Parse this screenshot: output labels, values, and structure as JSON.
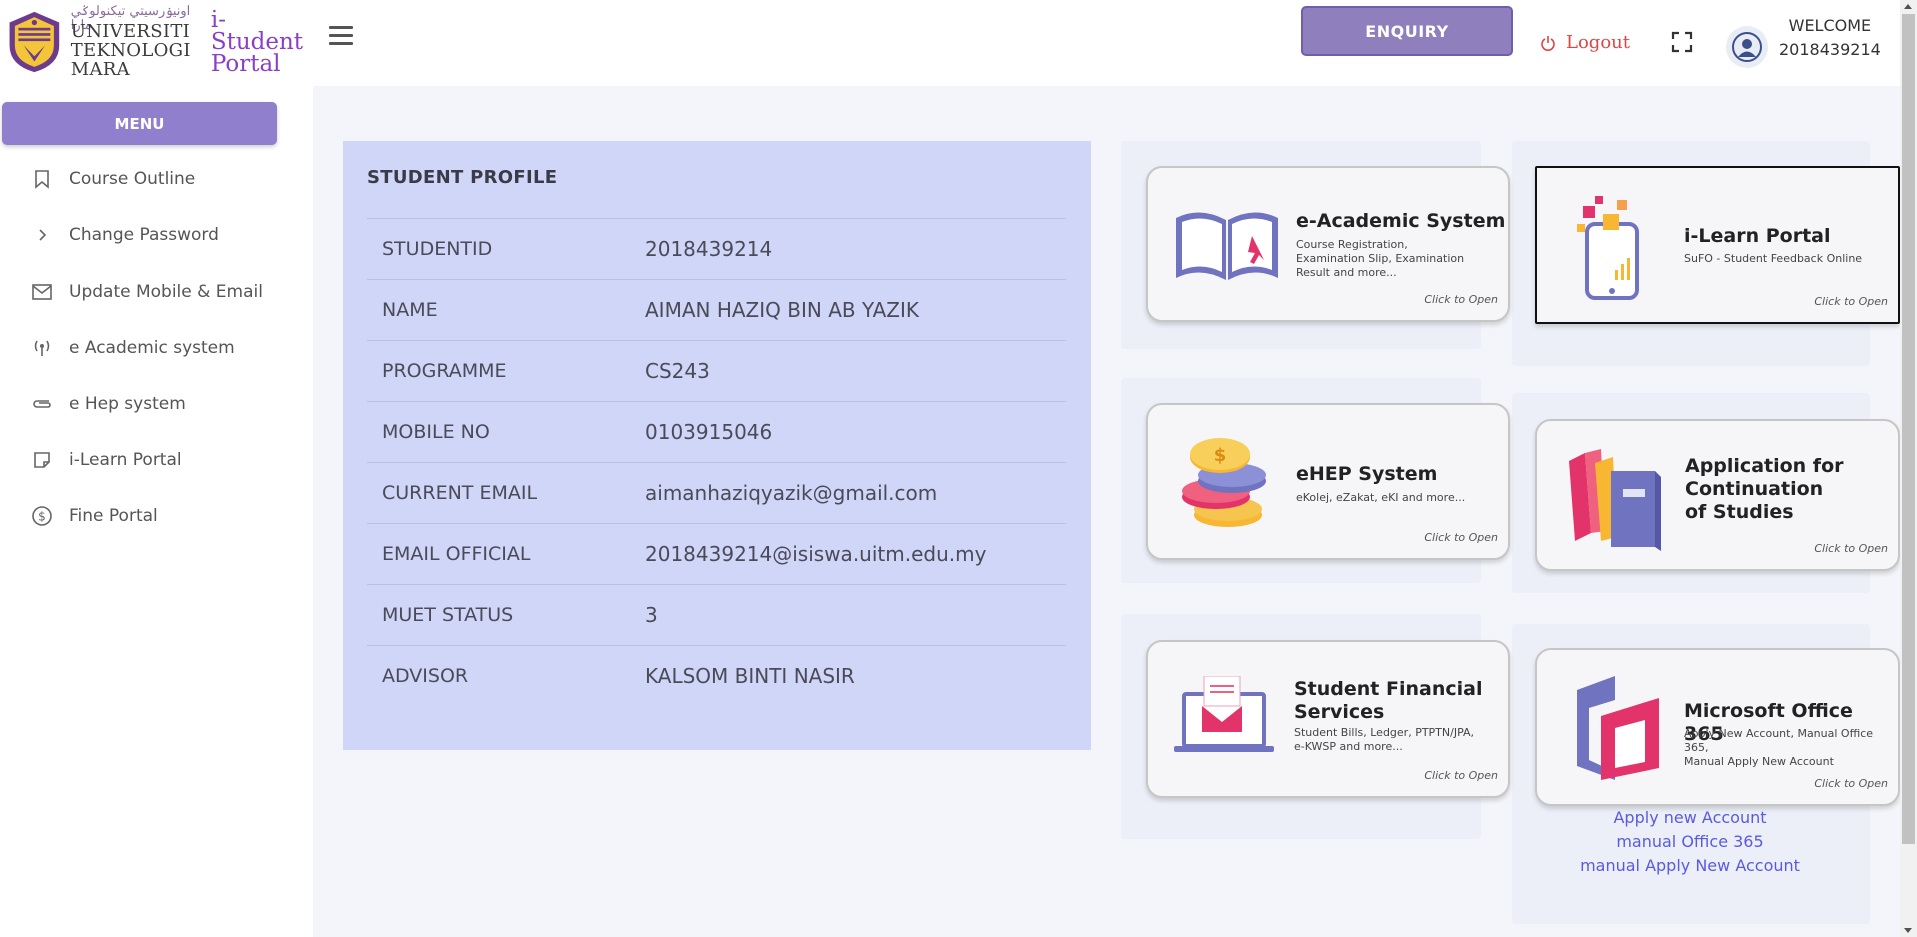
{
  "header": {
    "logo_jawi": "اونيۏرسيتي تيكنولوݢي مارا",
    "logo_line1": "UNIVERSITI",
    "logo_line2": "TEKNOLOGI",
    "logo_line3": "MARA",
    "portal_line1": "i-Student",
    "portal_line2": "Portal",
    "enquiry_label": "ENQUIRY",
    "logout_label": "Logout",
    "welcome_label": "WELCOME",
    "user_id": "2018439214"
  },
  "sidebar": {
    "menu_label": "MENU",
    "items": [
      {
        "label": "Course Outline",
        "icon": "bookmark-icon"
      },
      {
        "label": "Change Password",
        "icon": "chevron-right-icon"
      },
      {
        "label": "Update Mobile & Email",
        "icon": "mail-icon"
      },
      {
        "label": "e Academic system",
        "icon": "broadcast-icon"
      },
      {
        "label": "e Hep system",
        "icon": "paperclip-icon"
      },
      {
        "label": "i-Learn Portal",
        "icon": "sticky-note-icon"
      },
      {
        "label": "Fine Portal",
        "icon": "dollar-circle-icon"
      }
    ]
  },
  "profile": {
    "title": "STUDENT PROFILE",
    "rows": [
      {
        "key": "STUDENTID",
        "value": "2018439214"
      },
      {
        "key": "NAME",
        "value": "AIMAN HAZIQ BIN AB YAZIK"
      },
      {
        "key": "PROGRAMME",
        "value": "CS243"
      },
      {
        "key": "MOBILE NO",
        "value": "0103915046"
      },
      {
        "key": "CURRENT EMAIL",
        "value": "aimanhaziqyazik@gmail.com"
      },
      {
        "key": "EMAIL OFFICIAL",
        "value": "2018439214@isiswa.uitm.edu.my"
      },
      {
        "key": "MUET STATUS",
        "value": "3"
      },
      {
        "key": "ADVISOR",
        "value": "KALSOM BINTI NASIR"
      }
    ]
  },
  "tiles": {
    "eacademic": {
      "title": "e-Academic System",
      "sub1": "Course Registration,",
      "sub2": "Examination Slip, Examination",
      "sub3": "Result and more...",
      "open": "Click to Open"
    },
    "ilearn": {
      "title": "i-Learn Portal",
      "sub1": "SuFO - Student Feedback Online",
      "open": "Click to Open"
    },
    "ehep": {
      "title": "eHEP System",
      "sub1": "eKolej, eZakat, eKI and more...",
      "open": "Click to Open"
    },
    "continuation": {
      "title1": "Application for",
      "title2": "Continuation",
      "title3": "of Studies",
      "open": "Click to Open"
    },
    "financial": {
      "title1": "Student Financial",
      "title2": "Services",
      "sub1": "Student Bills, Ledger, PTPTN/JPA,",
      "sub2": "e-KWSP and more...",
      "open": "Click to Open"
    },
    "office": {
      "title": "Microsoft Office 365",
      "sub1": "Apply New Account, Manual Office 365,",
      "sub2": "Manual Apply New Account",
      "open": "Click to Open"
    }
  },
  "office_links": [
    "Apply new Account",
    "manual Office 365",
    "manual Apply New Account"
  ],
  "colors": {
    "accent": "#8f7fcc",
    "profile_bg": "#d0d6f7",
    "logout": "#e04444",
    "link": "#5a5ae0"
  }
}
